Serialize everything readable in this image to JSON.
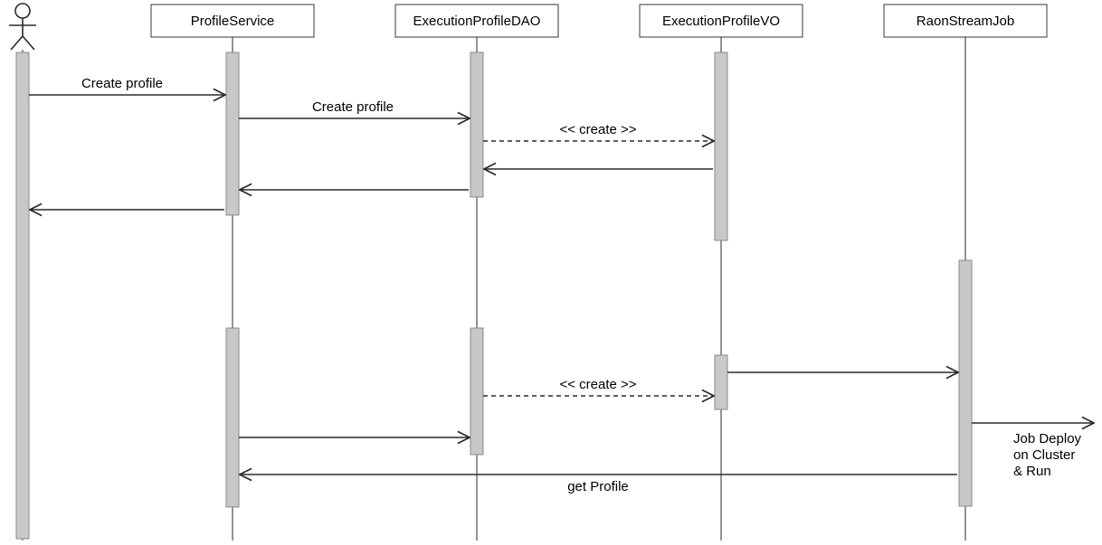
{
  "participants": {
    "profileService": "ProfileService",
    "executionProfileDAO": "ExecutionProfileDAO",
    "executionProfileVO": "ExecutionProfileVO",
    "raonStreamJob": "RaonStreamJob"
  },
  "messages": {
    "createProfile1": "Create profile",
    "createProfile2": "Create profile",
    "createStereo1": "<< create >>",
    "createStereo2": "<< create >>",
    "getProfile": "get Profile",
    "jobDeployLine1": "Job Deploy",
    "jobDeployLine2": "on Cluster",
    "jobDeployLine3": "& Run"
  },
  "chart_data": {
    "type": "table",
    "diagram_type": "UML Sequence Diagram",
    "participants": [
      "Actor",
      "ProfileService",
      "ExecutionProfileDAO",
      "ExecutionProfileVO",
      "RaonStreamJob"
    ],
    "interactions": [
      {
        "from": "Actor",
        "to": "ProfileService",
        "label": "Create profile",
        "type": "sync"
      },
      {
        "from": "ProfileService",
        "to": "ExecutionProfileDAO",
        "label": "Create profile",
        "type": "sync"
      },
      {
        "from": "ExecutionProfileDAO",
        "to": "ExecutionProfileVO",
        "label": "<< create >>",
        "type": "create"
      },
      {
        "from": "ExecutionProfileVO",
        "to": "ExecutionProfileDAO",
        "label": "",
        "type": "return"
      },
      {
        "from": "ExecutionProfileDAO",
        "to": "ProfileService",
        "label": "",
        "type": "return"
      },
      {
        "from": "ProfileService",
        "to": "Actor",
        "label": "",
        "type": "return"
      },
      {
        "from": "ExecutionProfileVO",
        "to": "RaonStreamJob",
        "label": "",
        "type": "sync"
      },
      {
        "from": "ExecutionProfileDAO",
        "to": "ExecutionProfileVO",
        "label": "<< create >>",
        "type": "create"
      },
      {
        "from": "RaonStreamJob",
        "to": "external",
        "label": "Job Deploy on Cluster & Run",
        "type": "sync"
      },
      {
        "from": "ProfileService",
        "to": "ExecutionProfileDAO",
        "label": "",
        "type": "sync"
      },
      {
        "from": "RaonStreamJob",
        "to": "ProfileService",
        "label": "get Profile",
        "type": "return"
      }
    ]
  }
}
